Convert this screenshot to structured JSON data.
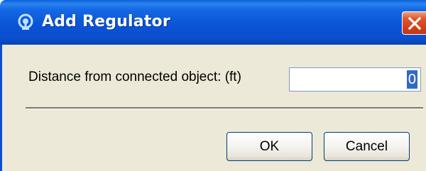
{
  "window": {
    "title": "Add Regulator",
    "icon": "regulator-app-icon",
    "close_icon": "close-icon"
  },
  "form": {
    "distance_label": "Distance from connected object: (ft)",
    "distance_value": "0"
  },
  "buttons": {
    "ok_label": "OK",
    "cancel_label": "Cancel"
  },
  "colors": {
    "titlebar": "#0b54d6",
    "client_background": "#ece9d8",
    "close_button": "#d2401a",
    "selection": "#316ac5"
  }
}
